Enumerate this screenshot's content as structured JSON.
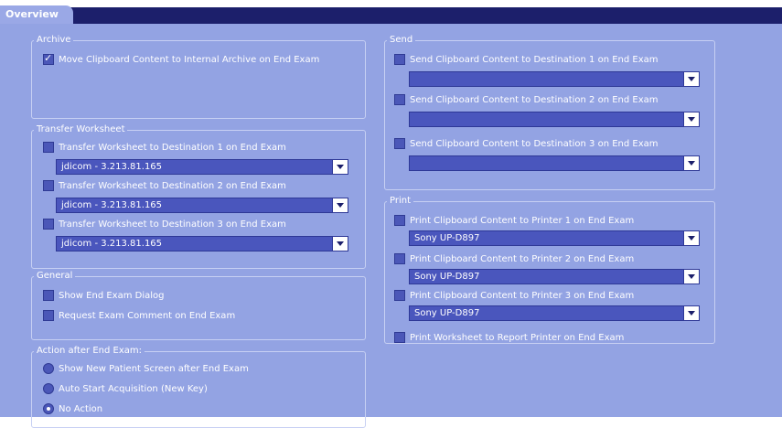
{
  "tab": {
    "label": "Overview"
  },
  "archive": {
    "legend": "Archive",
    "move_clipboard": {
      "label": "Move Clipboard Content to Internal Archive on End Exam",
      "checked": true
    }
  },
  "transfer": {
    "legend": "Transfer Worksheet",
    "items": [
      {
        "label": "Transfer Worksheet to Destination 1 on End Exam",
        "checked": false,
        "value": "jdicom - 3.213.81.165"
      },
      {
        "label": "Transfer Worksheet to Destination 2 on End Exam",
        "checked": false,
        "value": "jdicom - 3.213.81.165"
      },
      {
        "label": "Transfer Worksheet to Destination 3 on End Exam",
        "checked": false,
        "value": "jdicom - 3.213.81.165"
      }
    ]
  },
  "general": {
    "legend": "General",
    "show_dialog": {
      "label": "Show End Exam Dialog",
      "checked": false
    },
    "request_comment": {
      "label": "Request Exam Comment on End Exam",
      "checked": false
    }
  },
  "action": {
    "legend": "Action after End Exam:",
    "options": [
      {
        "label": "Show New Patient Screen after End Exam",
        "selected": false
      },
      {
        "label": "Auto Start Acquisition (New Key)",
        "selected": false
      },
      {
        "label": "No Action",
        "selected": true
      }
    ]
  },
  "send": {
    "legend": "Send",
    "items": [
      {
        "label": "Send Clipboard Content to Destination 1 on End Exam",
        "checked": false,
        "value": ""
      },
      {
        "label": "Send Clipboard Content to Destination 2 on End Exam",
        "checked": false,
        "value": ""
      },
      {
        "label": "Send Clipboard Content to Destination 3 on End Exam",
        "checked": false,
        "value": ""
      }
    ]
  },
  "print": {
    "legend": "Print",
    "items": [
      {
        "label": "Print Clipboard Content to Printer 1 on End Exam",
        "checked": false,
        "value": "Sony UP-D897"
      },
      {
        "label": "Print Clipboard Content to Printer 2 on End Exam",
        "checked": false,
        "value": "Sony UP-D897"
      },
      {
        "label": "Print Clipboard Content to Printer 3 on End Exam",
        "checked": false,
        "value": "Sony UP-D897"
      }
    ],
    "worksheet": {
      "label": "Print Worksheet to Report Printer on End Exam",
      "checked": false
    }
  },
  "colors": {
    "panel": "#93a3e3",
    "header": "#1c1f6b",
    "field": "#4a56bd"
  }
}
